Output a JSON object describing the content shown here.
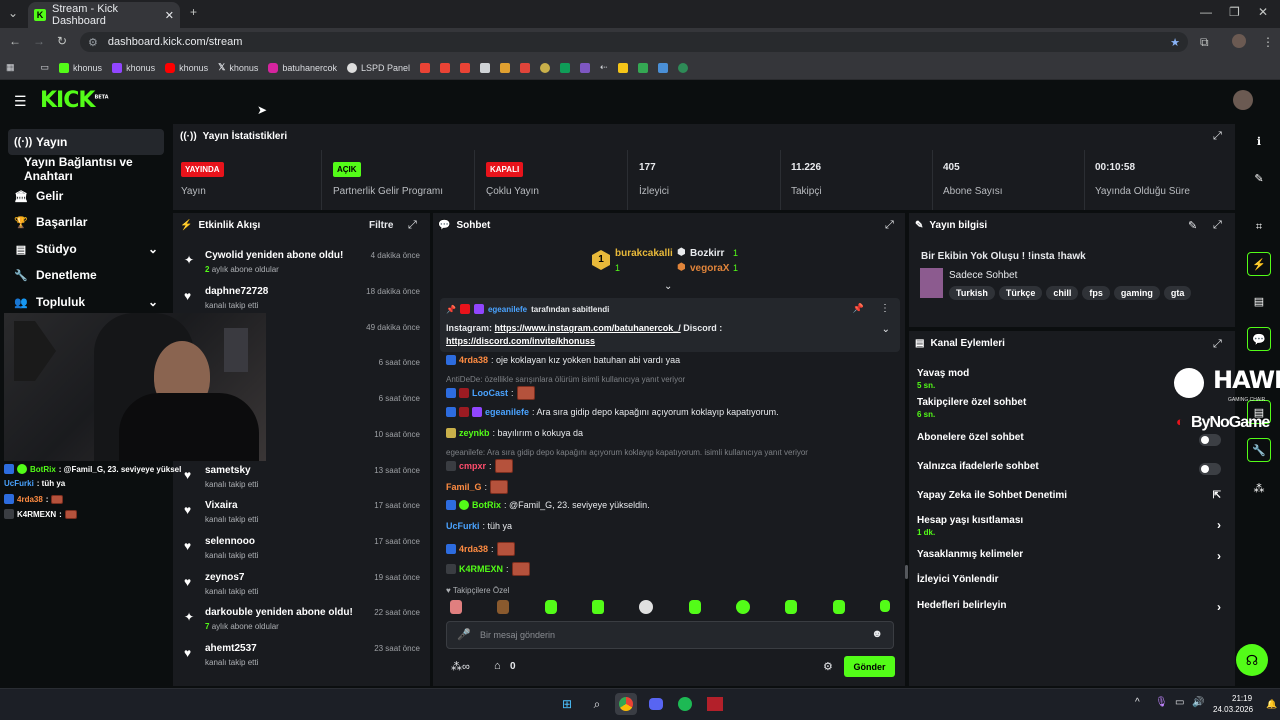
{
  "browser": {
    "tab_title": "Stream - Kick Dashboard",
    "url": "dashboard.kick.com/stream",
    "bookmarks": [
      "khonus",
      "khonus",
      "khonus",
      "khonus",
      "batuhanercok",
      "LSPD Panel"
    ]
  },
  "app": {
    "logo": "KICK",
    "logo_sup": "BETA"
  },
  "sidebar": {
    "items": [
      {
        "label": "Yayın",
        "icon": "broadcast-icon"
      },
      {
        "label": "Yayın Bağlantısı ve Anahtarı"
      },
      {
        "label": "Gelir",
        "icon": "bank-icon"
      },
      {
        "label": "Başarılar",
        "icon": "trophy-icon"
      },
      {
        "label": "Stüdyo",
        "icon": "studio-icon"
      },
      {
        "label": "Denetleme",
        "icon": "wrench-icon"
      },
      {
        "label": "Topluluk",
        "icon": "users-icon"
      }
    ]
  },
  "stats": {
    "title": "Yayın İstatistikleri",
    "cells": [
      {
        "badge": "YAYINDA",
        "badge_color": "#e8131b",
        "label": "Yayın"
      },
      {
        "badge": "AÇIK",
        "badge_color": "#53fc18",
        "label": "Partnerlik Gelir Programı"
      },
      {
        "badge": "KAPALI",
        "badge_color": "#e8131b",
        "label": "Çoklu Yayın"
      },
      {
        "value": "177",
        "label": "İzleyici"
      },
      {
        "value": "11.226",
        "label": "Takipçi"
      },
      {
        "value": "405",
        "label": "Abone Sayısı"
      },
      {
        "value": "00:10:58",
        "label": "Yayında Olduğu Süre"
      }
    ]
  },
  "feed": {
    "title": "Etkinlik Akışı",
    "filter": "Filtre",
    "items": [
      {
        "name": "Cywolid yeniden abone oldu!",
        "sub_num": "2",
        "sub": "aylık abone oldular",
        "time": "4 dakika önce",
        "icon": "sparkle"
      },
      {
        "name": "daphne72728",
        "sub": "kanalı takip etti",
        "time": "18 dakika önce",
        "icon": "heart"
      },
      {
        "name": "",
        "sub": "",
        "time": "49 dakika önce",
        "icon": "heart"
      },
      {
        "name": "",
        "sub": "",
        "time": "6 saat önce",
        "icon": "heart"
      },
      {
        "name": "",
        "sub": "",
        "time": "6 saat önce",
        "icon": "heart"
      },
      {
        "name": "",
        "sub": "",
        "time": "10 saat önce",
        "icon": "heart"
      },
      {
        "name": "sametsky",
        "sub": "kanalı takip etti",
        "time": "13 saat önce",
        "icon": "heart"
      },
      {
        "name": "Vixaira",
        "sub": "kanalı takip etti",
        "time": "17 saat önce",
        "icon": "heart"
      },
      {
        "name": "selennooo",
        "sub": "kanalı takip etti",
        "time": "17 saat önce",
        "icon": "heart"
      },
      {
        "name": "zeynos7",
        "sub": "kanalı takip etti",
        "time": "19 saat önce",
        "icon": "heart"
      },
      {
        "name": "darkouble yeniden abone oldu!",
        "sub_num": "7",
        "sub": "aylık abone oldular",
        "time": "22 saat önce",
        "icon": "sparkle"
      },
      {
        "name": "ahemt2537",
        "sub": "kanalı takip etti",
        "time": "23 saat önce",
        "icon": "heart"
      }
    ]
  },
  "chat": {
    "title": "Sohbet",
    "leaders": [
      {
        "name": "burakcakalli",
        "count": "1"
      },
      {
        "name": "Bozkirr",
        "count": "1"
      },
      {
        "name": "vegoraX",
        "count": "1"
      }
    ],
    "pinned_by": "egeanilefe",
    "pinned_label": "tarafından sabitlendi",
    "pinned_text": "Instagram: ",
    "pinned_link1": "https://www.instagram.com/batuhanercok_/",
    "pinned_mid": " Discord :",
    "pinned_link2": "https://discord.com/invite/khonuss",
    "messages": [
      {
        "user": "4rda38",
        "color": "#ff8c42",
        "text": ": oje koklayan kız yokken batuhan abi vardı yaa"
      },
      {
        "reply": "AntiDeDe: özellikle sarışınlara ölürüm isimli kullanıcıya yanıt veriyor"
      },
      {
        "user": "LooCast",
        "color": "#4aa3ff",
        "text": ":"
      },
      {
        "user": "egeanilefe",
        "color": "#4aa3ff",
        "text": ": Ara sıra gidip depo kapağını açıyorum koklayıp kapatıyorum."
      },
      {
        "user": "zeynkb",
        "color": "#53fc18",
        "text": ": bayılırım o kokuya da"
      },
      {
        "reply": "egeanilefe: Ara sıra gidip depo kapağını açıyorum koklayıp kapatıyorum. isimli kullanıcıya yanıt veriyor"
      },
      {
        "user": "cmpxr",
        "color": "#ff4d6d",
        "text": ":"
      },
      {
        "user": "Famil_G",
        "color": "#ff8c42",
        "text": ":"
      },
      {
        "user": "BotRix",
        "color": "#53fc18",
        "text": ": @Famil_G, 23. seviyeye yükseldin."
      },
      {
        "user": "UcFurki",
        "color": "#4aa3ff",
        "text": ": tüh ya"
      },
      {
        "user": "4rda38",
        "color": "#ff8c42",
        "text": ":"
      },
      {
        "user": "K4RMEXN",
        "color": "#53fc18",
        "text": ":"
      }
    ],
    "followers_label": "Takipçilere Özel",
    "input_placeholder": "Bir mesaj gönderin",
    "points": "0",
    "send": "Gönder"
  },
  "info": {
    "title": "Yayın bilgisi",
    "stream_title": "Bir Ekibin Yok Oluşu ! !insta !hawk",
    "category": "Sadece Sohbet",
    "tags": [
      "Turkish",
      "Türkçe",
      "chill",
      "fps",
      "gaming",
      "gta"
    ]
  },
  "actions": {
    "title": "Kanal Eylemleri",
    "rows": [
      {
        "label": "Yavaş mod",
        "sub": "5 sn."
      },
      {
        "label": "Takipçilere özel sohbet",
        "sub": "6 sn."
      },
      {
        "label": "Abonelere özel sohbet",
        "toggle": true
      },
      {
        "label": "Yalnızca ifadelerle sohbet",
        "toggle": true
      },
      {
        "label": "Yapay Zeka ile Sohbet Denetimi"
      },
      {
        "label": "Hesap yaşı kısıtlaması",
        "sub": "1 dk.",
        "chev": true
      },
      {
        "label": "Yasaklanmış kelimeler",
        "chev": true
      },
      {
        "label": "İzleyici Yönlendir"
      },
      {
        "label": "Hedefleri belirleyin",
        "chev": true
      }
    ]
  },
  "overlay": {
    "hawk": "HAWK",
    "hawk_sub": "GAMING CHAIR",
    "bynogame": "ByNoGame",
    "chat": [
      {
        "user": "BotRix",
        "text": ": @Famil_G, 23. seviyeye yüksel"
      },
      {
        "user": "UcFurki",
        "text": ": tüh ya"
      },
      {
        "user": "4rda38",
        "text": ":"
      },
      {
        "user": "K4RMEXN",
        "text": ":"
      }
    ]
  },
  "taskbar": {
    "time": "21:19",
    "date": "24.03.2026"
  }
}
